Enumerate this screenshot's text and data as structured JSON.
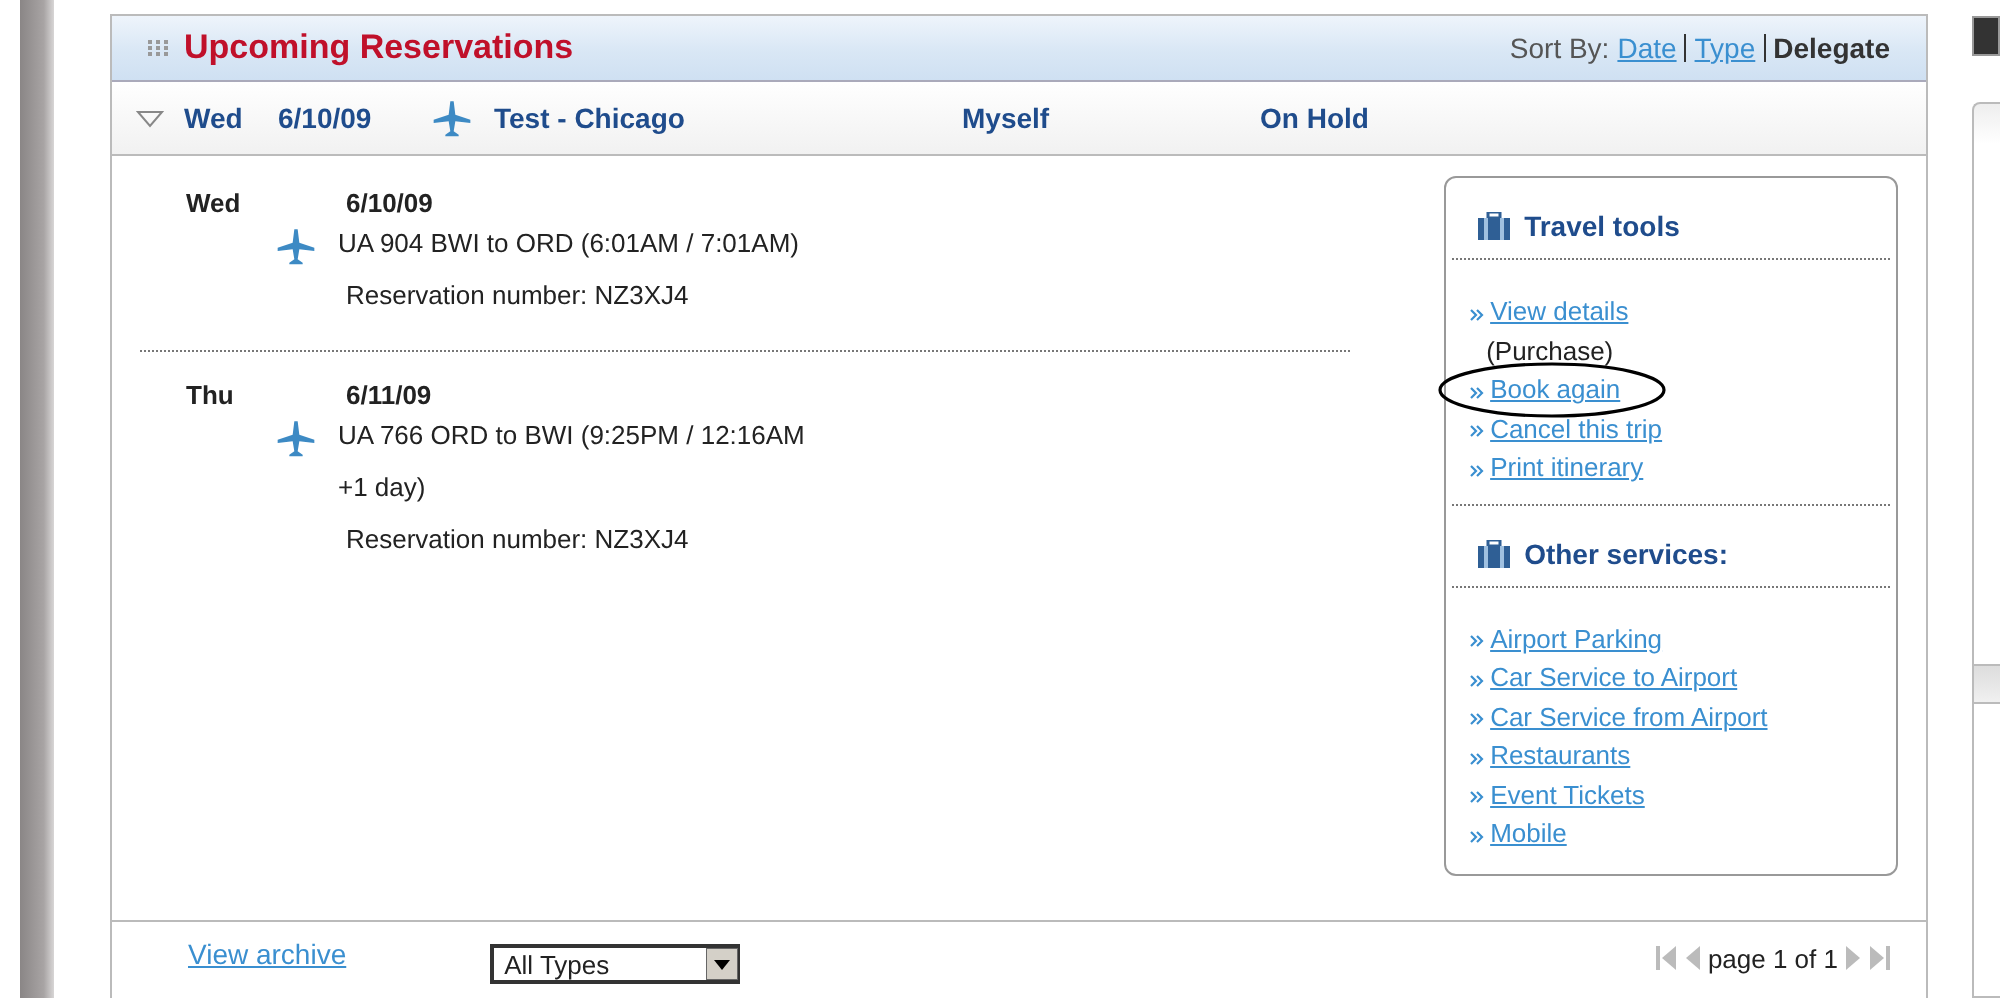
{
  "panel": {
    "title": "Upcoming Reservations",
    "sort_label": "Sort By:",
    "sort_options": [
      {
        "label": "Date",
        "selected": false
      },
      {
        "label": "Type",
        "selected": false
      },
      {
        "label": "Delegate",
        "selected": true
      }
    ]
  },
  "trip": {
    "expanded": true,
    "day": "Wed",
    "date": "6/10/09",
    "name": "Test - Chicago",
    "traveler": "Myself",
    "status": "On Hold"
  },
  "itinerary": [
    {
      "day": "Wed",
      "date": "6/10/09",
      "flight": "UA 904 BWI to ORD (6:01AM / 7:01AM)",
      "reservation": "Reservation number: NZ3XJ4"
    },
    {
      "day": "Thu",
      "date": "6/11/09",
      "flight": "UA 766 ORD to BWI (9:25PM / 12:16AM +1 day)",
      "reservation": "Reservation number: NZ3XJ4"
    }
  ],
  "tool_sections": [
    {
      "title": "Travel tools",
      "items": [
        {
          "label": "View details",
          "note": "(Purchase)",
          "circled": false
        },
        {
          "label": "Book again",
          "circled": true
        },
        {
          "label": "Cancel this trip",
          "circled": false
        },
        {
          "label": "Print itinerary",
          "circled": false
        }
      ]
    },
    {
      "title": "Other services:",
      "items": [
        {
          "label": "Airport Parking",
          "circled": false
        },
        {
          "label": "Car Service to Airport",
          "circled": false
        },
        {
          "label": "Car Service from Airport",
          "circled": false
        },
        {
          "label": "Restaurants",
          "circled": false
        },
        {
          "label": "Event Tickets",
          "circled": false
        },
        {
          "label": "Mobile",
          "circled": false
        }
      ]
    }
  ],
  "footer": {
    "archive_link": "View archive",
    "type_filter": "All Types",
    "pager": "page 1 of 1"
  }
}
